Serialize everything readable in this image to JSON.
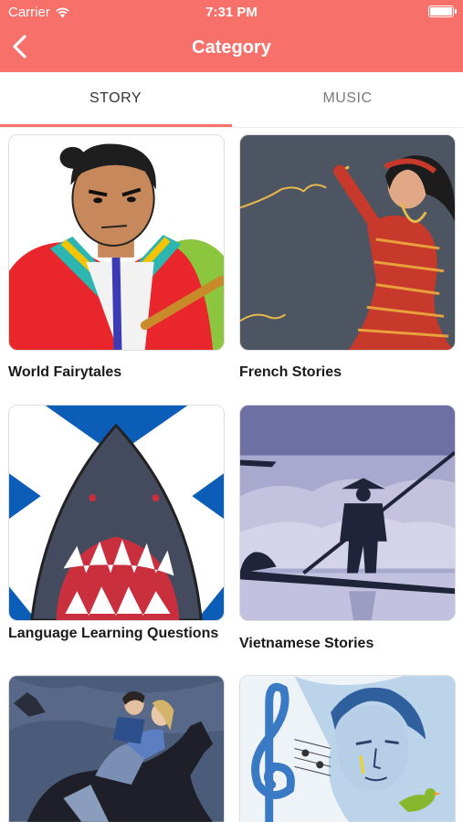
{
  "status_bar": {
    "carrier": "Carrier",
    "time": "7:31 PM"
  },
  "nav": {
    "title": "Category"
  },
  "tabs": [
    {
      "label": "STORY",
      "selected": true
    },
    {
      "label": "MUSIC",
      "selected": false
    }
  ],
  "colors": {
    "accent": "#f8706a"
  },
  "categories": [
    {
      "title": "World Fairytales",
      "icon": "samurai-illustration"
    },
    {
      "title": "French Stories",
      "icon": "dancer-illustration"
    },
    {
      "title": "Language Learning Questions",
      "icon": "shark-flag-illustration"
    },
    {
      "title": "Vietnamese Stories",
      "icon": "boatman-illustration"
    },
    {
      "title": "",
      "icon": "horse-riders-illustration"
    },
    {
      "title": "",
      "icon": "music-portrait-illustration"
    }
  ]
}
